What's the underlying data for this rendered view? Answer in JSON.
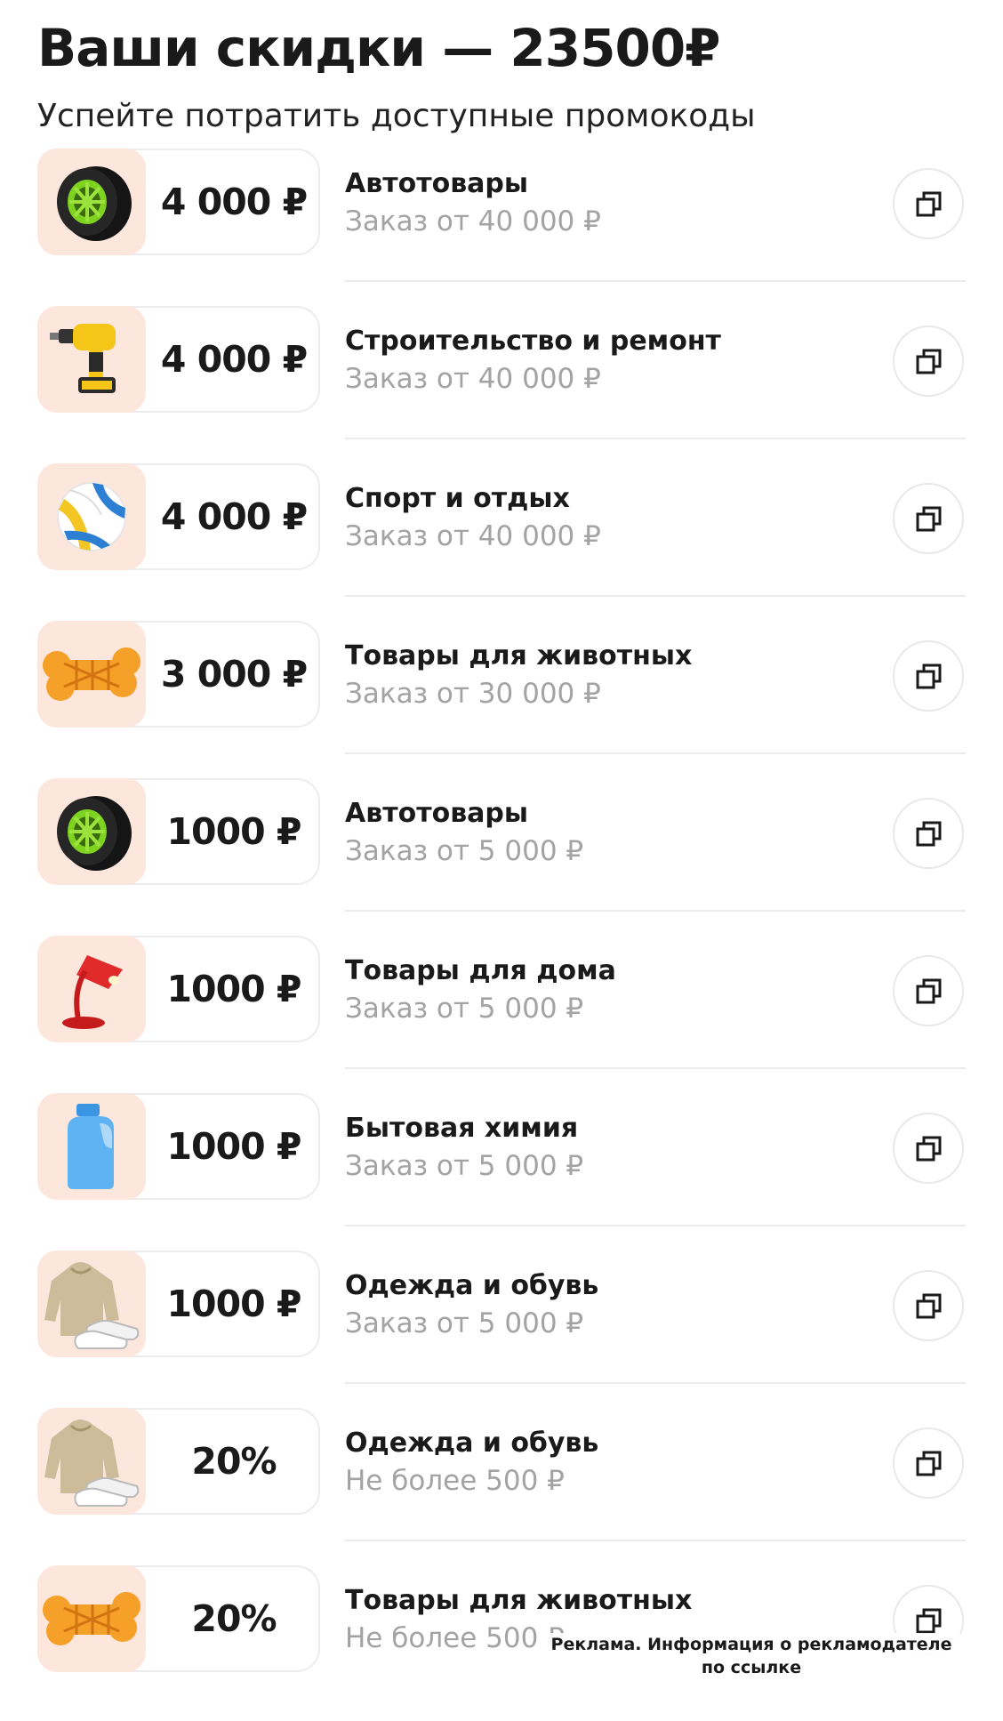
{
  "header": {
    "title": "Ваши скидки — 23500₽",
    "subtitle": "Успейте потратить доступные промокоды"
  },
  "promos": [
    {
      "image": "tire-icon",
      "amount": "4 000 ₽",
      "category": "Автотовары",
      "condition": "Заказ от 40 000 ₽"
    },
    {
      "image": "drill-icon",
      "amount": "4 000 ₽",
      "category": "Строительство и ремонт",
      "condition": "Заказ от 40 000 ₽"
    },
    {
      "image": "volleyball-icon",
      "amount": "4 000 ₽",
      "category": "Спорт и отдых",
      "condition": "Заказ от 40 000 ₽"
    },
    {
      "image": "bone-toy-icon",
      "amount": "3 000 ₽",
      "category": "Товары для животных",
      "condition": "Заказ от 30 000 ₽"
    },
    {
      "image": "tire-icon",
      "amount": "1000 ₽",
      "category": "Автотовары",
      "condition": "Заказ от 5 000 ₽"
    },
    {
      "image": "lamp-icon",
      "amount": "1000 ₽",
      "category": "Товары для дома",
      "condition": "Заказ от 5 000 ₽"
    },
    {
      "image": "detergent-bottle-icon",
      "amount": "1000 ₽",
      "category": "Бытовая химия",
      "condition": "Заказ от 5 000 ₽"
    },
    {
      "image": "hoodie-sneakers-icon",
      "amount": "1000 ₽",
      "category": "Одежда и обувь",
      "condition": "Заказ от 5 000 ₽"
    },
    {
      "image": "hoodie-sneakers-icon",
      "amount": "20%",
      "category": "Одежда и обувь",
      "condition": "Не более 500 ₽"
    },
    {
      "image": "bone-toy-icon",
      "amount": "20%",
      "category": "Товары для животных",
      "condition": "Не более 500 ₽"
    }
  ],
  "copy_icon": "copy-icon",
  "ad_notice": "Реклама. Информация о рекламодателе по ссылке",
  "colors": {
    "thumb_background": "#fde6dc",
    "condition_text": "#a3a3a3",
    "divider": "#ebebeb"
  }
}
